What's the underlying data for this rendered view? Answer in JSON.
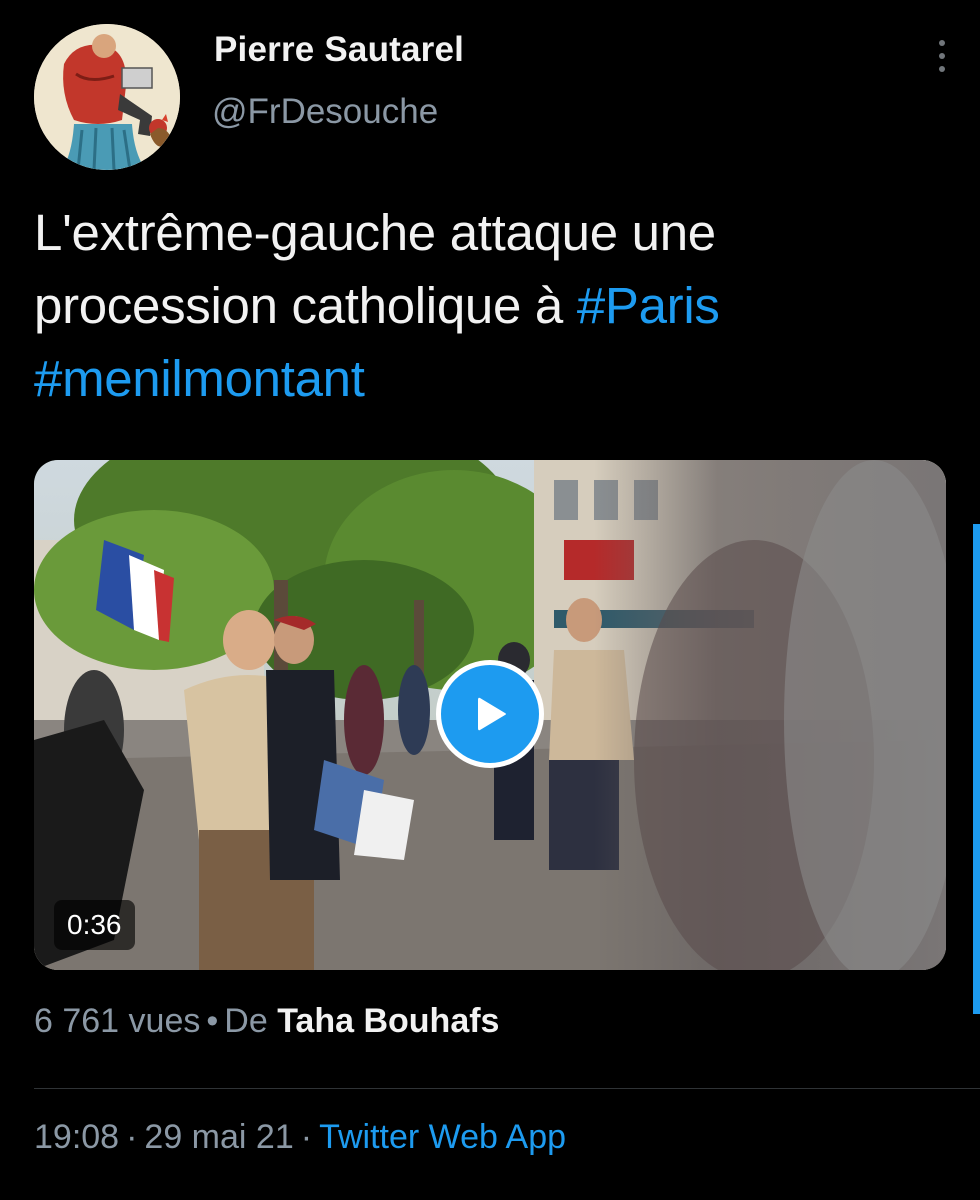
{
  "author": {
    "name": "Pierre Sautarel",
    "handle": "@FrDesouche"
  },
  "tweet": {
    "text_parts": [
      "L'extrême-gauche attaque une procession catholique à ",
      "#Paris",
      " ",
      "#menilmontant"
    ]
  },
  "video": {
    "duration": "0:36"
  },
  "stats": {
    "views": "6 761 vues",
    "separator": "•",
    "from_label": "De",
    "source_name": "Taha Bouhafs"
  },
  "meta": {
    "time": "19:08",
    "separator": "·",
    "date": "29 mai 21",
    "client": "Twitter Web App"
  },
  "icons": {
    "more": "more-vertical-icon",
    "play": "play-icon"
  },
  "colors": {
    "background": "#000000",
    "text": "#f2f2f2",
    "secondary": "#8b98a5",
    "accent": "#1d9bf0"
  }
}
